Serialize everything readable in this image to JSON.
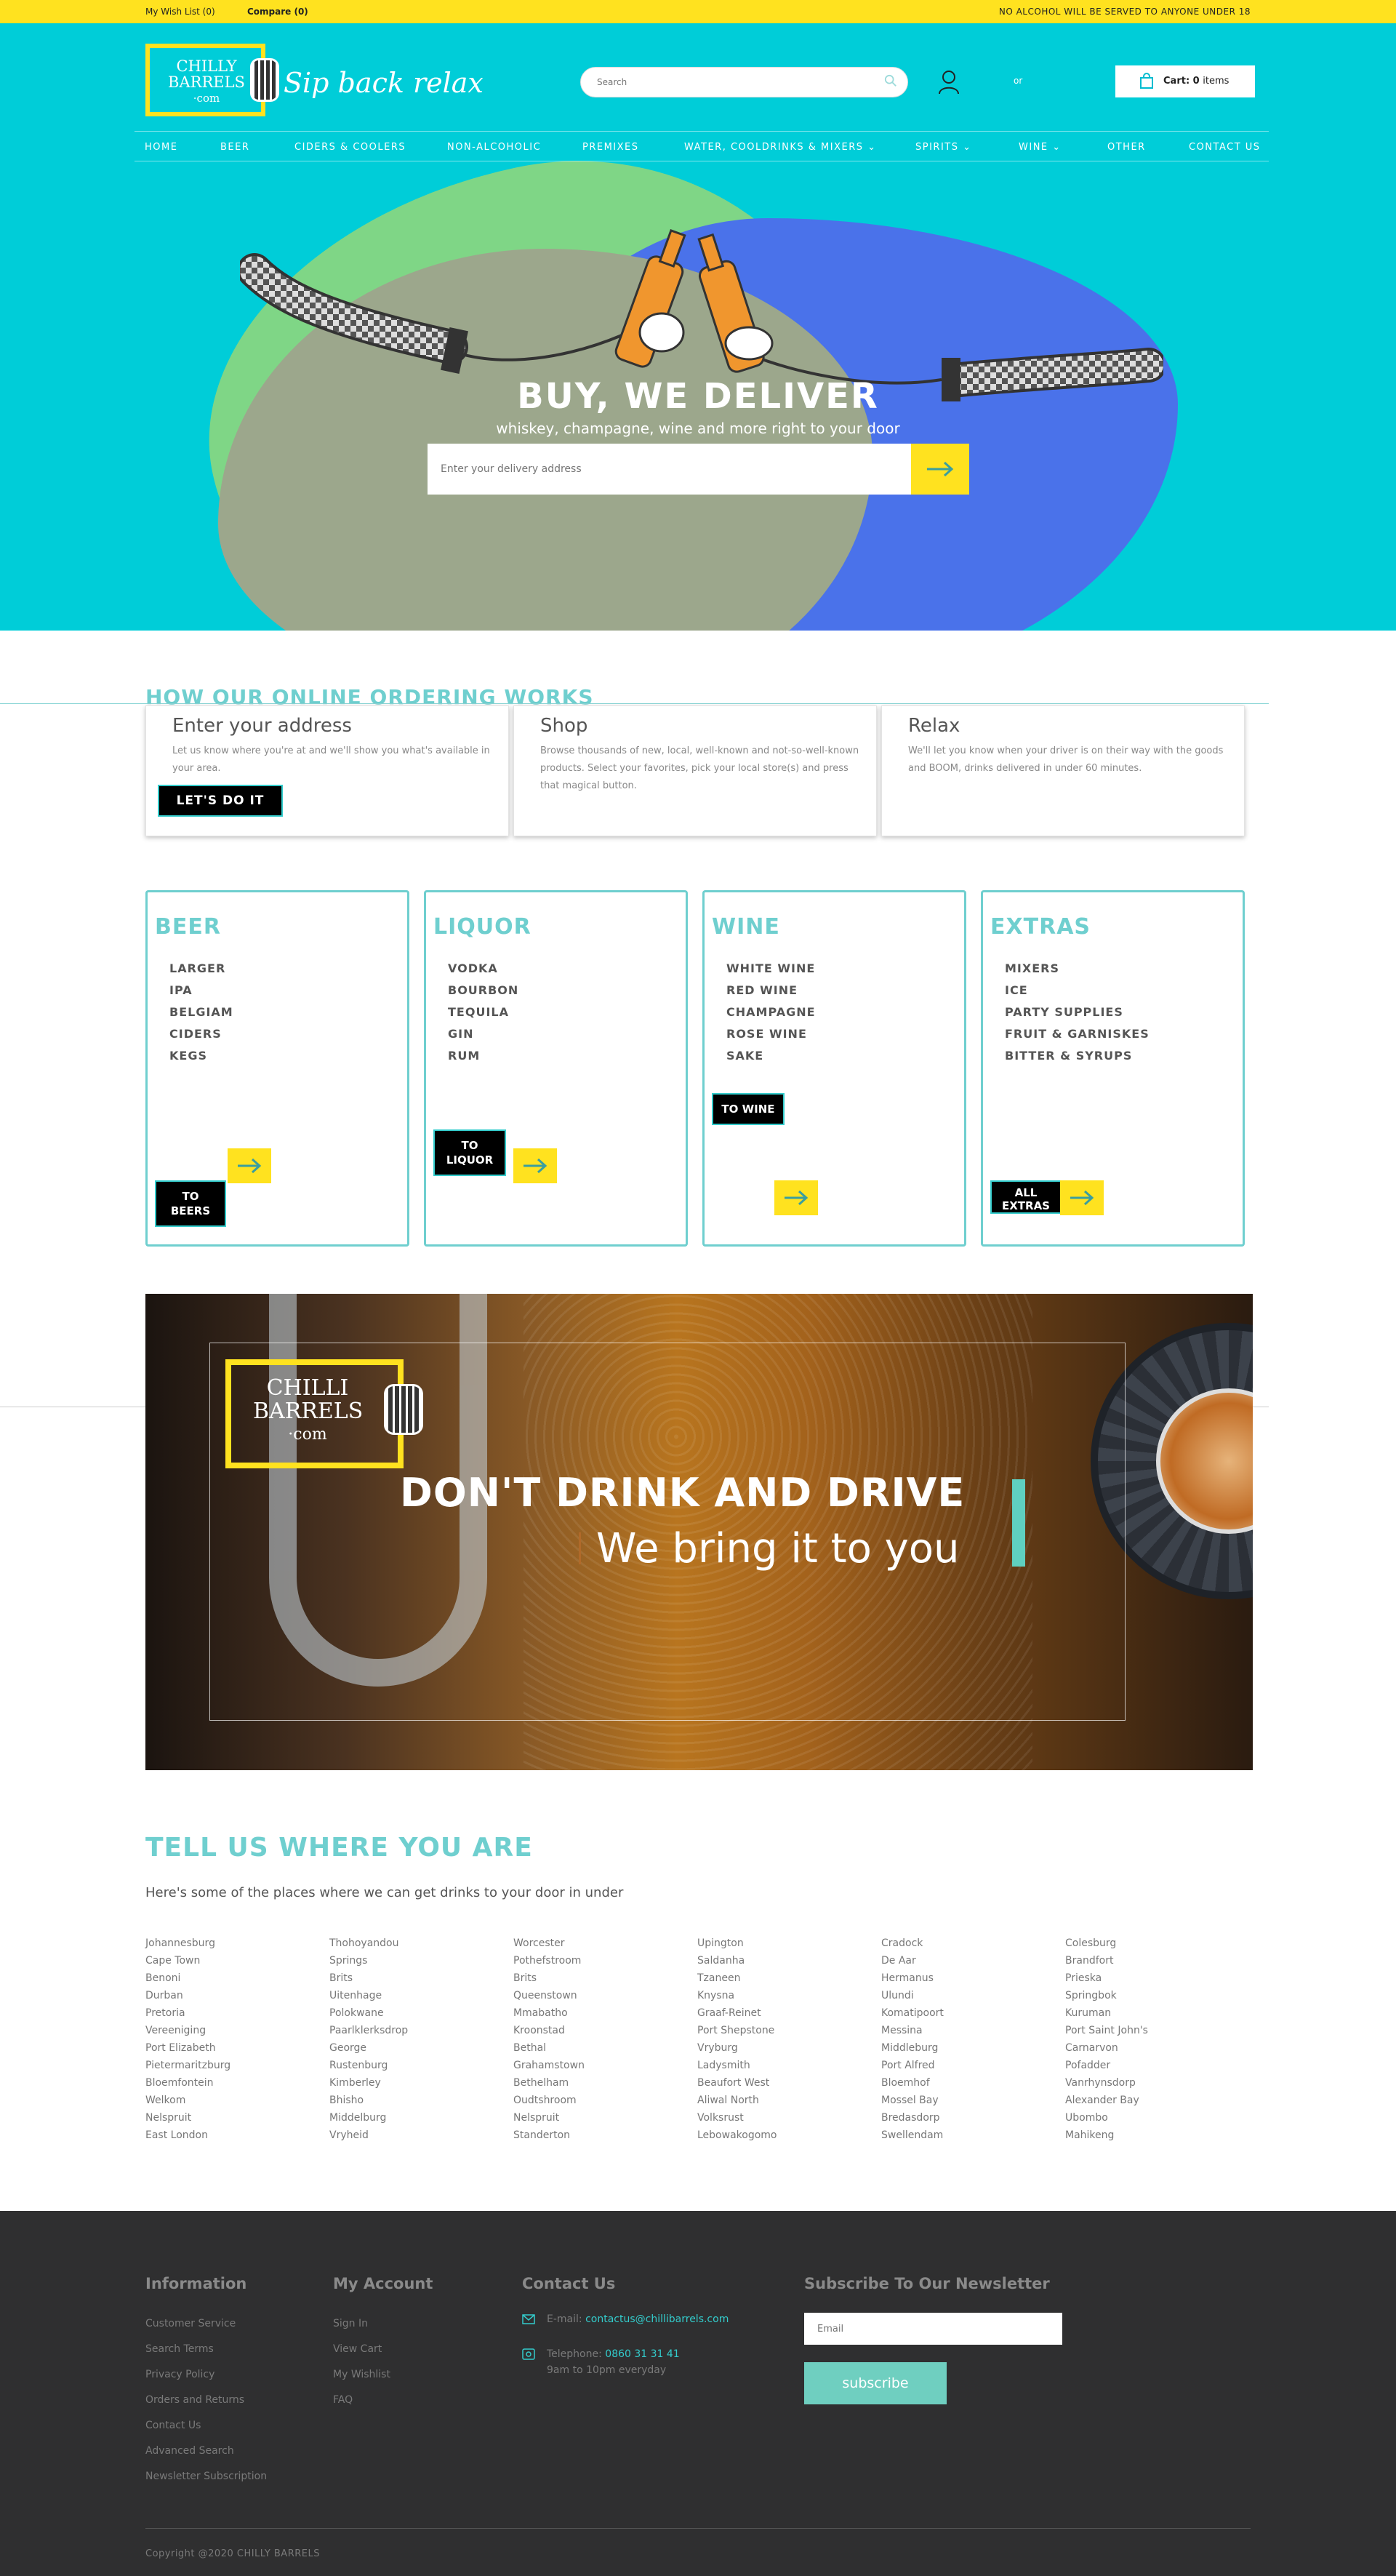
{
  "topbar": {
    "wishlist": "My Wish List (0)",
    "compare": "Compare (0)",
    "notice": "NO ALCOHOL WILL BE SERVED TO ANYONE UNDER 18"
  },
  "header": {
    "logo_line1": "CHILLY",
    "logo_line2": "BARRELS",
    "logo_line3": "·com",
    "tagline": "Sip back relax",
    "search_placeholder": "Search",
    "or_text": "or",
    "cart_label": "Cart:",
    "cart_count": "0",
    "cart_items": "items"
  },
  "nav": [
    {
      "label": "HOME"
    },
    {
      "label": "BEER"
    },
    {
      "label": "CIDERS & COOLERS"
    },
    {
      "label": "NON-ALCOHOLIC"
    },
    {
      "label": "PREMIXES"
    },
    {
      "label": "WATER, COOLDRINKS & MIXERS ⌄"
    },
    {
      "label": "SPIRITS ⌄"
    },
    {
      "label": "WINE ⌄"
    },
    {
      "label": "OTHER"
    },
    {
      "label": "CONTACT US"
    }
  ],
  "hero": {
    "title": "BUY, WE DELIVER",
    "subtitle": "whiskey, champagne, wine and more right to your door",
    "address_placeholder": "Enter your delivery address"
  },
  "how": {
    "title": "HOW OUR ONLINE ORDERING WORKS",
    "cards": [
      {
        "title": "Enter your address",
        "text": "Let us know where you're at and we'll show you what's available in your area.",
        "button": "LET'S DO IT"
      },
      {
        "title": "Shop",
        "text": "Browse thousands of new, local, well-known and not-so-well-known products. Select your favorites, pick your local store(s) and press that magical button."
      },
      {
        "title": "Relax",
        "text": "We'll let you know when your driver is on their way with the goods and BOOM, drinks delivered in under 60 minutes."
      }
    ]
  },
  "categories": [
    {
      "title": "BEER",
      "items": [
        "LARGER",
        "IPA",
        "BELGIAM",
        "CIDERS",
        "KEGS"
      ],
      "button": "TO BEERS"
    },
    {
      "title": "LIQUOR",
      "items": [
        "VODKA",
        "BOURBON",
        "TEQUILA",
        "GIN",
        "RUM"
      ],
      "button": "TO LIQUOR"
    },
    {
      "title": "WINE",
      "items": [
        "WHITE WINE",
        "RED WINE",
        "CHAMPAGNE",
        "ROSE WINE",
        "SAKE"
      ],
      "button": "TO WINE"
    },
    {
      "title": "EXTRAS",
      "items": [
        "MIXERS",
        "ICE",
        "PARTY SUPPLIES",
        "FRUIT & GARNISKES",
        "BITTER & SYRUPS"
      ],
      "button": "ALL EXTRAS"
    }
  ],
  "banner": {
    "logo_line1": "CHILLI",
    "logo_line2": "BARRELS",
    "logo_line3": "·com",
    "headline": "DON'T DRINK AND DRIVE",
    "subline": "We bring it to you"
  },
  "locations": {
    "title": "TELL US WHERE YOU ARE",
    "subtitle": "Here's some of the places where we can get drinks to your door in under",
    "columns": [
      [
        "Johannesburg",
        "Cape Town",
        "Benoni",
        "Durban",
        "Pretoria",
        "Vereeniging",
        "Port Elizabeth",
        "Pietermaritzburg",
        "Bloemfontein",
        "Welkom",
        "Nelspruit",
        "East London"
      ],
      [
        "Thohoyandou",
        "Springs",
        "Brits",
        "Uitenhage",
        "Polokwane",
        "Paarlklerksdrop",
        "George",
        "Rustenburg",
        "Kimberley",
        "Bhisho",
        "Middelburg",
        "Vryheid"
      ],
      [
        "Worcester",
        "Pothefstroom",
        "Brits",
        "Queenstown",
        "Mmabatho",
        "Kroonstad",
        "Bethal",
        "Grahamstown",
        "Bethelham",
        "Oudtshroom",
        "Nelspruit",
        "Standerton"
      ],
      [
        "Upington",
        "Saldanha",
        "Tzaneen",
        "Knysna",
        "Graaf-Reinet",
        "Port Shepstone",
        "Vryburg",
        "Ladysmith",
        "Beaufort West",
        "Aliwal North",
        "Volksrust",
        "Lebowakogomo"
      ],
      [
        "Cradock",
        "De Aar",
        "Hermanus",
        "Ulundi",
        "Komatipoort",
        "Messina",
        "Middleburg",
        "Port Alfred",
        "Bloemhof",
        "Mossel Bay",
        "Bredasdorp",
        "Swellendam"
      ],
      [
        "Colesburg",
        "Brandfort",
        "Prieska",
        "Springbok",
        "Kuruman",
        "Port Saint John's",
        "Carnarvon",
        "Pofadder",
        "Vanrhynsdorp",
        "Alexander Bay",
        "Ubombo",
        "Mahikeng"
      ]
    ]
  },
  "footer": {
    "information": {
      "title": "Information",
      "items": [
        "Customer Service",
        "Search Terms",
        "Privacy Policy",
        "Orders and Returns",
        "Contact Us",
        "Advanced Search",
        "Newsletter Subscription"
      ]
    },
    "account": {
      "title": "My Account",
      "items": [
        "Sign In",
        "View Cart",
        "My Wishlist",
        "FAQ"
      ]
    },
    "contact": {
      "title": "Contact Us",
      "email_label": "E-mail:",
      "email": "contactus@chillibarrels.com",
      "phone_label": "Telephone:",
      "phone": "0860 31 31 41",
      "hours": "9am to 10pm everyday"
    },
    "newsletter": {
      "title": "Subscribe To Our Newsletter",
      "placeholder": "Email",
      "button": "subscribe"
    },
    "copyright": "Copyright @2020 CHILLY BARRELS"
  },
  "colors": {
    "accent": "#00cdd8",
    "yellow": "#ffe21f",
    "teal": "#6fcfcf",
    "footer": "#2f2f30"
  }
}
